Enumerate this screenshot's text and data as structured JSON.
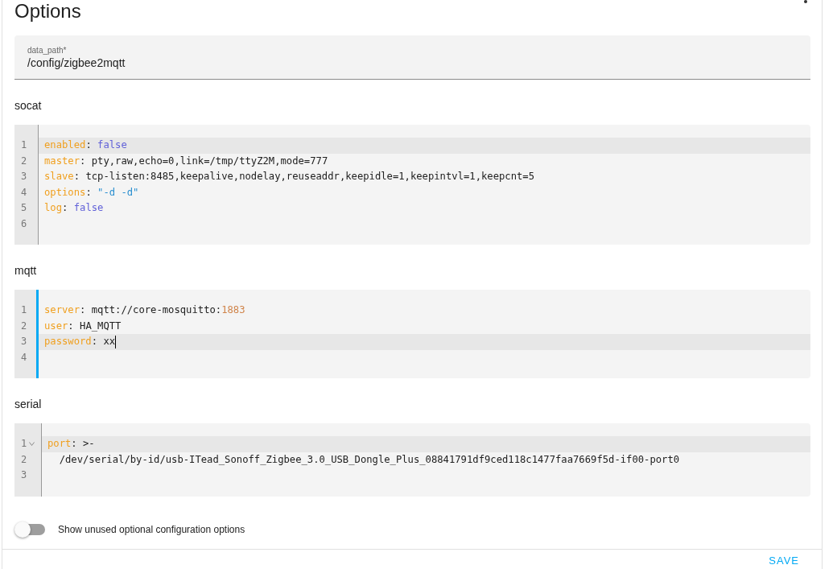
{
  "title": "Options",
  "data_path": {
    "label": "data_path*",
    "value": "/config/zigbee2mqtt"
  },
  "sections": [
    {
      "label": "socat",
      "focused": false,
      "lines": [
        {
          "number": "1",
          "active": true,
          "foldable": false,
          "cursor": false,
          "tokens": [
            {
              "kind": "key",
              "text": "enabled"
            },
            {
              "kind": "punct",
              "text": ": "
            },
            {
              "kind": "bool",
              "text": "false"
            }
          ]
        },
        {
          "number": "2",
          "active": false,
          "foldable": false,
          "cursor": false,
          "tokens": [
            {
              "kind": "key",
              "text": "master"
            },
            {
              "kind": "punct",
              "text": ": "
            },
            {
              "kind": "plain",
              "text": "pty,raw,echo=0,link=/tmp/ttyZ2M,mode=777"
            }
          ]
        },
        {
          "number": "3",
          "active": false,
          "foldable": false,
          "cursor": false,
          "tokens": [
            {
              "kind": "key",
              "text": "slave"
            },
            {
              "kind": "punct",
              "text": ": "
            },
            {
              "kind": "plain",
              "text": "tcp-listen:8485,keepalive,nodelay,reuseaddr,keepidle=1,keepintvl=1,keepcnt=5"
            }
          ]
        },
        {
          "number": "4",
          "active": false,
          "foldable": false,
          "cursor": false,
          "tokens": [
            {
              "kind": "key",
              "text": "options"
            },
            {
              "kind": "punct",
              "text": ": "
            },
            {
              "kind": "string",
              "text": "\"-d -d\""
            }
          ]
        },
        {
          "number": "5",
          "active": false,
          "foldable": false,
          "cursor": false,
          "tokens": [
            {
              "kind": "key",
              "text": "log"
            },
            {
              "kind": "punct",
              "text": ": "
            },
            {
              "kind": "bool",
              "text": "false"
            }
          ]
        },
        {
          "number": "6",
          "active": false,
          "foldable": false,
          "cursor": false
        }
      ]
    },
    {
      "label": "mqtt",
      "focused": true,
      "lines": [
        {
          "number": "1",
          "active": false,
          "foldable": false,
          "cursor": false,
          "tokens": [
            {
              "kind": "key",
              "text": "server"
            },
            {
              "kind": "punct",
              "text": ": "
            },
            {
              "kind": "plain",
              "text": "mqtt://core-mosquitto:"
            },
            {
              "kind": "number",
              "text": "1883"
            }
          ]
        },
        {
          "number": "2",
          "active": false,
          "foldable": false,
          "cursor": false,
          "tokens": [
            {
              "kind": "key",
              "text": "user"
            },
            {
              "kind": "punct",
              "text": ": "
            },
            {
              "kind": "plain",
              "text": "HA_MQTT"
            }
          ]
        },
        {
          "number": "3",
          "active": true,
          "foldable": false,
          "cursor": true,
          "tokens": [
            {
              "kind": "key",
              "text": "password"
            },
            {
              "kind": "punct",
              "text": ": "
            },
            {
              "kind": "plain",
              "text": "xx"
            }
          ]
        },
        {
          "number": "4",
          "active": false,
          "foldable": false,
          "cursor": false
        }
      ]
    },
    {
      "label": "serial",
      "focused": false,
      "lines": [
        {
          "number": "1",
          "active": true,
          "foldable": true,
          "cursor": false,
          "tokens": [
            {
              "kind": "key",
              "text": "port"
            },
            {
              "kind": "punct",
              "text": ": >-"
            }
          ]
        },
        {
          "number": "2",
          "active": false,
          "foldable": false,
          "cursor": false,
          "tokens": [
            {
              "kind": "plain",
              "text": "  /dev/serial/by-id/usb-ITead_Sonoff_Zigbee_3.0_USB_Dongle_Plus_08841791df9ced118c1477faa7669f5d-if00-port0"
            }
          ]
        },
        {
          "number": "3",
          "active": false,
          "foldable": false,
          "cursor": false
        }
      ]
    }
  ],
  "toggle": {
    "label": "Show unused optional configuration options",
    "on": false
  },
  "save_button": "SAVE"
}
